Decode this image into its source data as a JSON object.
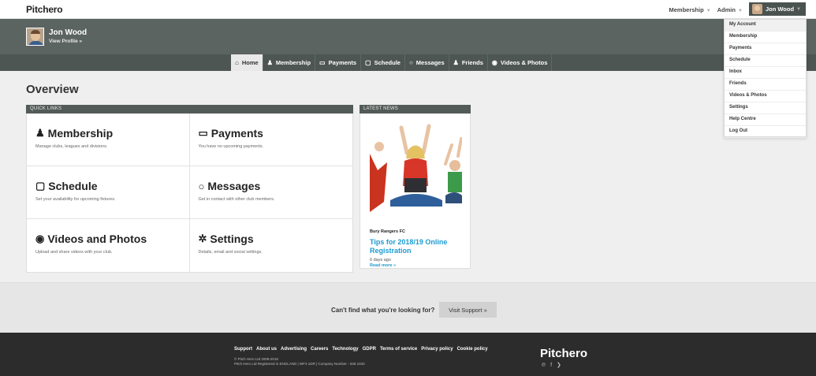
{
  "topbar": {
    "logo": "Pitchero",
    "links": [
      {
        "label": "Membership"
      },
      {
        "label": "Admin"
      }
    ],
    "user_button": "Jon Wood"
  },
  "profile": {
    "name": "Jon Wood",
    "view_link": "View Profile »"
  },
  "nav": [
    {
      "label": "Home",
      "icon": "home-icon",
      "glyph": "⌂"
    },
    {
      "label": "Membership",
      "icon": "membership-icon",
      "glyph": "♟"
    },
    {
      "label": "Payments",
      "icon": "card-icon",
      "glyph": "▭"
    },
    {
      "label": "Schedule",
      "icon": "calendar-icon",
      "glyph": "▢"
    },
    {
      "label": "Messages",
      "icon": "chat-icon",
      "glyph": "○"
    },
    {
      "label": "Friends",
      "icon": "friends-icon",
      "glyph": "♟"
    },
    {
      "label": "Videos & Photos",
      "icon": "play-icon",
      "glyph": "◉"
    }
  ],
  "overview_title": "Overview",
  "quick_links": {
    "heading": "QUICK LINKS",
    "tiles": [
      {
        "title": "Membership",
        "desc": "Manage clubs, leagues and divisions.",
        "icon": "membership-icon",
        "glyph": "♟"
      },
      {
        "title": "Payments",
        "desc": "You have no upcoming payments.",
        "icon": "card-icon",
        "glyph": "▭"
      },
      {
        "title": "Schedule",
        "desc": "Set your availability for upcoming fixtures.",
        "icon": "calendar-icon",
        "glyph": "▢"
      },
      {
        "title": "Messages",
        "desc": "Get in contact with other club members.",
        "icon": "chat-icon",
        "glyph": "○"
      },
      {
        "title": "Videos and Photos",
        "desc": "Upload and share videos with your club.",
        "icon": "play-icon",
        "glyph": "◉"
      },
      {
        "title": "Settings",
        "desc": "Details, email and social settings.",
        "icon": "gear-icon",
        "glyph": "✲"
      }
    ]
  },
  "news": {
    "heading": "LATEST NEWS",
    "club": "Bury Rangers FC",
    "title": "Tips for 2018/19 Online Registration",
    "date": "6 days ago",
    "read_more": "Read more »"
  },
  "support": {
    "text": "Can't find what you're looking for?",
    "button": "Visit Support »"
  },
  "footer": {
    "links": [
      "Support",
      "About us",
      "Advertising",
      "Careers",
      "Technology",
      "GDPR",
      "Terms of service",
      "Privacy policy",
      "Cookie policy"
    ],
    "copy1": "© Pitch Hero Ltd 2008-2018",
    "copy2": "Pitch Hero Ltd Registered in ENGLAND | WF3 1DR | Company Number - 636 1033",
    "logo": "Pitchero",
    "social": "℗ f ❯"
  },
  "dropdown": [
    "My Account",
    "Membership",
    "Payments",
    "Schedule",
    "Inbox",
    "Friends",
    "Videos & Photos",
    "Settings",
    "Help Centre",
    "Log Out"
  ]
}
